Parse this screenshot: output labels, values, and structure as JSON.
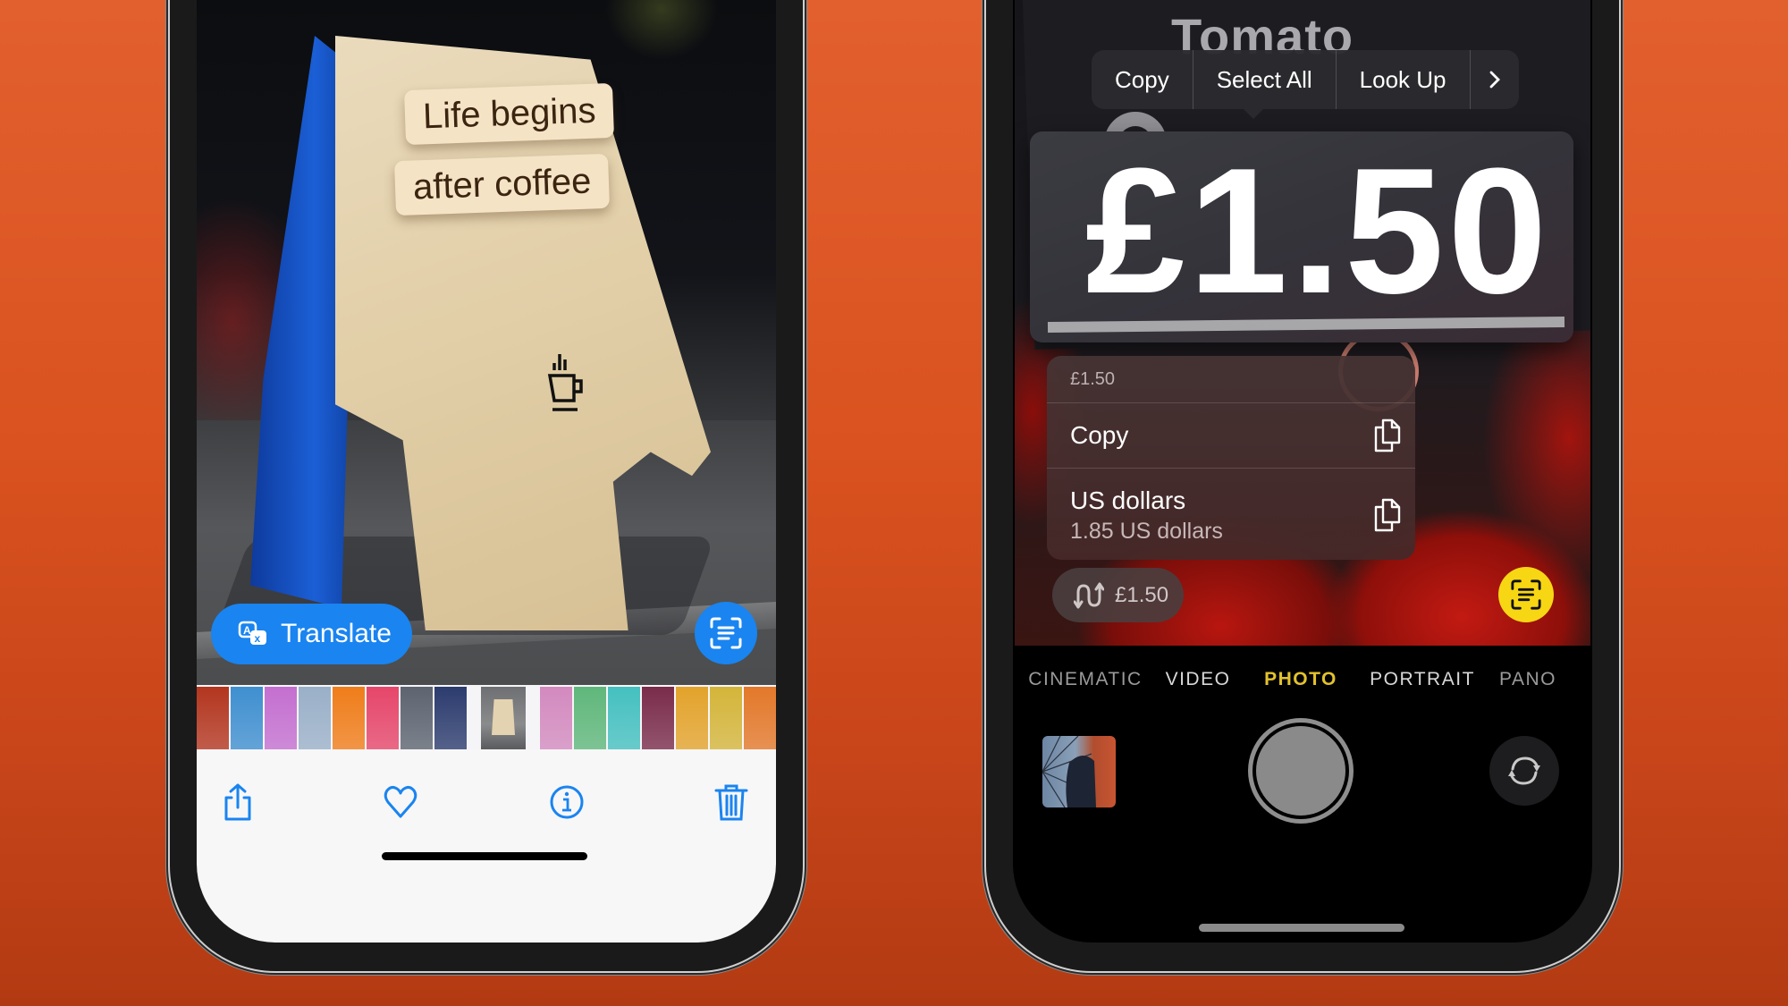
{
  "left_phone": {
    "app": "Photos",
    "sign": {
      "line1": "Life begins",
      "line2": "after coffee",
      "icon": "coffee-cup-icon"
    },
    "translate_button": {
      "label": "Translate",
      "icon": "translate-icon"
    },
    "live_text_button": {
      "icon": "live-text-scan-icon"
    },
    "filmstrip": {
      "thumbnails": [
        "#b3361f",
        "#3f8fd0",
        "#c46fd0",
        "#9ab0c8",
        "#f07d1a",
        "#e6466a",
        "#5d6470",
        "#2c3c6e",
        "sign",
        "#d38abf",
        "#5fb77b",
        "#45c0c0",
        "#7a2c4a",
        "#e3a32b",
        "#d4b53a",
        "#e3782a",
        "#d6d6d6"
      ],
      "selected_index": 8
    },
    "toolbar": {
      "items": [
        {
          "name": "share",
          "icon": "share-icon"
        },
        {
          "name": "favorite",
          "icon": "heart-icon"
        },
        {
          "name": "info",
          "icon": "info-icon"
        },
        {
          "name": "delete",
          "icon": "trash-icon"
        }
      ],
      "accent_color": "#1a84f0"
    }
  },
  "right_phone": {
    "app": "Camera",
    "scene": {
      "background_text": "Tomato",
      "detected_text": "£1.50"
    },
    "context_menu": {
      "items": [
        "Copy",
        "Select All",
        "Look Up"
      ],
      "more_icon": "chevron-right-icon"
    },
    "popup": {
      "header": "£1.50",
      "rows": [
        {
          "title": "Copy",
          "subtitle": null,
          "icon": "copy-icon"
        },
        {
          "title": "US dollars",
          "subtitle": "1.85 US dollars",
          "icon": "copy-icon"
        }
      ]
    },
    "conversion_pill": {
      "label": "£1.50",
      "icon": "convert-icon"
    },
    "live_text_button": {
      "icon": "live-text-scan-icon",
      "color": "#f7d613"
    },
    "modes": {
      "items": [
        "CINEMATIC",
        "VIDEO",
        "PHOTO",
        "PORTRAIT",
        "PANO"
      ],
      "active": "PHOTO",
      "active_color": "#e2c12e"
    },
    "controls": {
      "thumbnail": "last-photo-thumbnail",
      "shutter": "shutter-button",
      "flip": "flip-camera-icon"
    }
  }
}
